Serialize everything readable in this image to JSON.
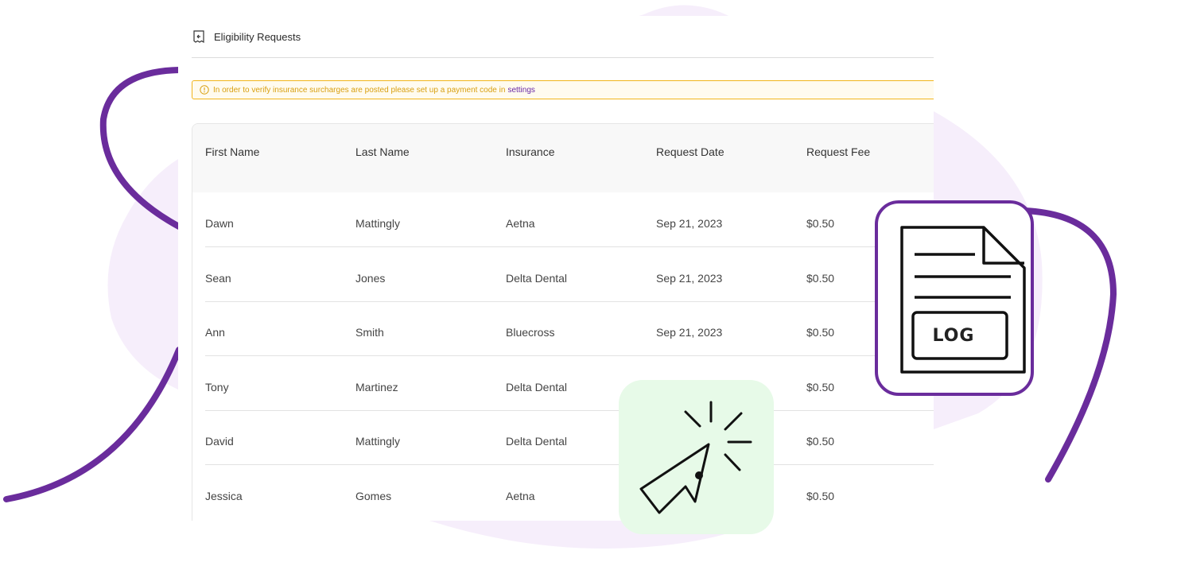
{
  "header": {
    "title": "Eligibility Requests",
    "icon": "receipt-back-icon"
  },
  "alert": {
    "icon": "warning-circle-icon",
    "message": "In order to verify insurance surcharges are posted please set up a payment code in",
    "link_text": "settings"
  },
  "table": {
    "columns": [
      "First Name",
      "Last Name",
      "Insurance",
      "Request Date",
      "Request Fee"
    ],
    "rows": [
      [
        "Dawn",
        "Mattingly",
        "Aetna",
        "Sep 21, 2023",
        "$0.50"
      ],
      [
        "Sean",
        "Jones",
        "Delta Dental",
        "Sep 21, 2023",
        "$0.50"
      ],
      [
        "Ann",
        "Smith",
        "Bluecross",
        "Sep 21, 2023",
        "$0.50"
      ],
      [
        "Tony",
        "Martinez",
        "Delta Dental",
        "",
        "$0.50"
      ],
      [
        "David",
        "Mattingly",
        "Delta Dental",
        "",
        "$0.50"
      ],
      [
        "Jessica",
        "Gomes",
        "Aetna",
        "",
        "$0.50"
      ]
    ]
  },
  "log_card": {
    "icon": "log-file-icon",
    "label": "LOG"
  },
  "click_card": {
    "icon": "cursor-click-icon"
  },
  "colors": {
    "accent_purple": "#6a2c9c",
    "blob_lavender": "#f6eefb",
    "alert_border": "#f2b51c",
    "alert_text": "#d9a010",
    "link": "#6b2aa5",
    "click_card_bg": "#e7fae8"
  }
}
